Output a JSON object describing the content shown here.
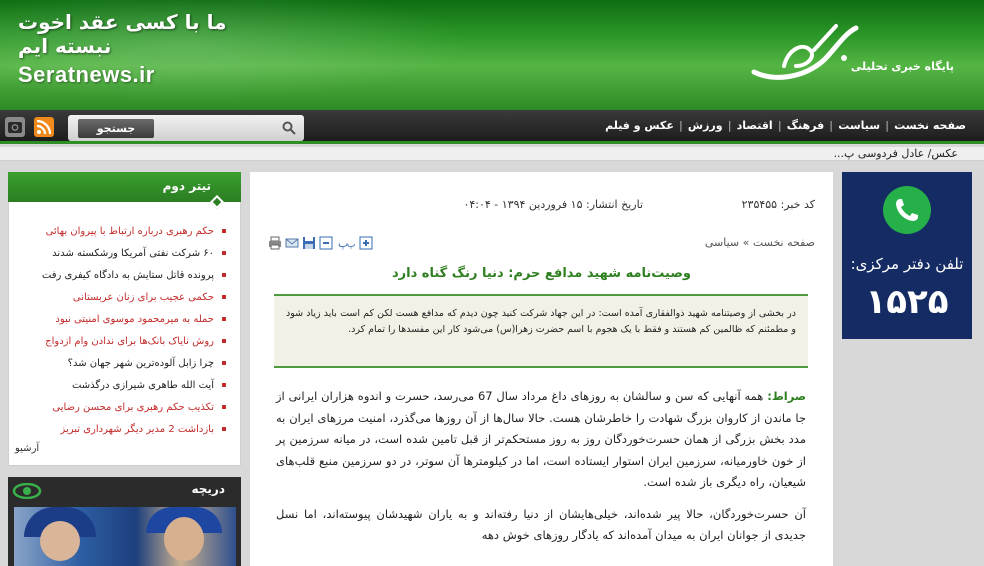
{
  "header": {
    "slogan": "ما با کسی عقد اخوت نبسته ایم",
    "site_url": "Seratnews.ir",
    "logo_text": "صراط",
    "logo_subtitle": "پایگاه خبری تحلیلی"
  },
  "nav": {
    "items": [
      "صفحه نخست",
      "سیاست",
      "فرهنگ",
      "اقتصاد",
      "ورزش",
      "عکس و فیلم"
    ],
    "search_label": "جستجو",
    "icons": [
      "search-icon",
      "rss-icon",
      "instagram-icon"
    ]
  },
  "ticker": {
    "text": "عکس/ عادل فردوسی پ..."
  },
  "ad": {
    "label": "تلفن دفتر مرکزی:",
    "number": "۱۵۲۵",
    "accent": "#25b04a",
    "background": "#152b63"
  },
  "article": {
    "code": "کد خبر: ۲۳۵۴۵۵",
    "date": "تاریخ انتشار: ۱۵ فروردین ۱۳۹۴ - ۰۴:۰۴",
    "breadcrumb": "صفحه نخست » سیاسی",
    "headline": "وصیت‌نامه شهید مدافع حرم: دنیا رنگ گناه دارد",
    "lead": "در بخشی از وصیتنامه شهید ذوالفقاری آمده است: در این جهاد شرکت کنید چون دیدم که مدافع هست لکن کم است باید زیاد شود و مطمئنم که ظالمین کم هستند و فقط با یک هجوم با اسم حضرت زهرا(س) می‌شود کار این مفسدها را تمام کرد.",
    "body_lead_word": "صراط:",
    "body_p1": " همه آنهایی که سن و سالشان به روزهای داغ مرداد سال 67 می‌رسد، حسرت و اندوه هزاران ایرانی از جا ماندن از کاروان بزرگ شهادت را خاطرشان هست. حالا سال‌ها از آن روزها می‌گذرد، امنیت مرزهای ایران به مدد بخش بزرگی از همان حسرت‌خوردگان روز به روز مستحکم‌تر از قبل تامین شده است، در میانه سرزمین پر از خون خاورمیانه، سرزمین ایران استوار ایستاده است، اما در کیلومترها آن سوتر، در دو سرزمین منبع قلب‌های شیعیان، راه دیگری باز شده است.",
    "body_p2": "آن حسرت‌خوردگان، حالا پیر شده‌اند، خیلی‌هایشان از دنیا رفته‌اند و به یاران شهیدشان پیوسته‌اند، اما نسل جدیدی از جوانان ایران به میدان آمده‌اند که یادگار روزهای خوش دهه"
  },
  "sidebar": {
    "box2_title": "تیتر دوم",
    "items": [
      {
        "text": "حکم رهبری درباره ارتباط با پیروان بهائی",
        "color": "red"
      },
      {
        "text": "۶۰ شرکت نفتی آمریکا ورشکسته شدند",
        "color": "dark"
      },
      {
        "text": "پرونده قاتل ستایش به دادگاه کیفری رفت",
        "color": "dark"
      },
      {
        "text": "حکمی عجیب برای زنان عربستانی",
        "color": "red"
      },
      {
        "text": "حمله به میرمحمود موسوی امنیتی نبود",
        "color": "red"
      },
      {
        "text": "روش نایاک بانک‌ها برای ندادن وام ازدواج",
        "color": "red"
      },
      {
        "text": "چرا زابل آلوده‌ترین شهر جهان شد؟",
        "color": "dark"
      },
      {
        "text": "آیت الله طاهری شیرازی درگذشت",
        "color": "dark"
      },
      {
        "text": "تکذیب حکم رهبری برای محسن رضایی",
        "color": "red"
      },
      {
        "text": "بازداشت 2 مدیر دیگر شهرداری تبریز",
        "color": "red"
      }
    ],
    "archive_label": "آرشیو",
    "box3_title": "دریچه"
  },
  "colors": {
    "brand_green": "#2f8d27",
    "headline_green": "#2f7f21",
    "link_red": "#c52a2a"
  }
}
